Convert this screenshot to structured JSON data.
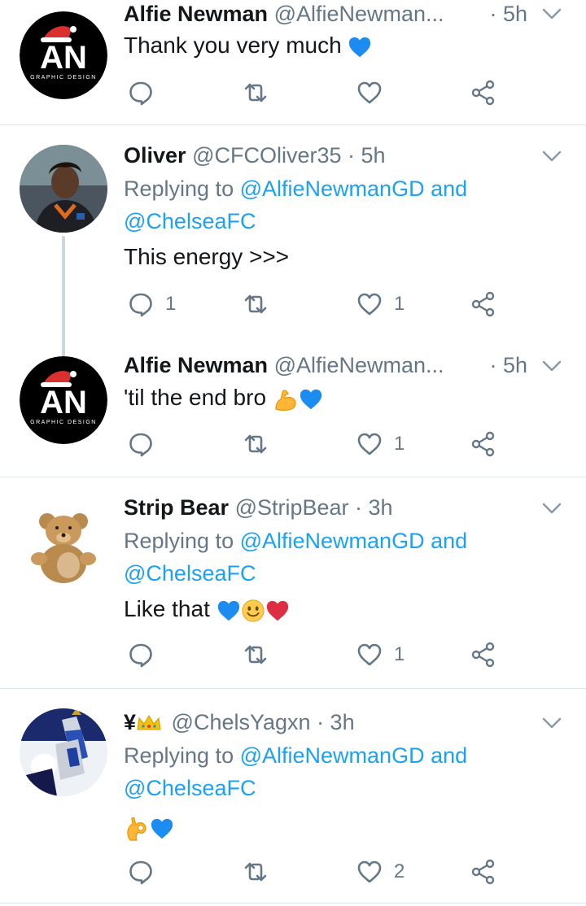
{
  "tweets": [
    {
      "name": "Alfie Newman",
      "handle": "@AlfieNewman...",
      "time": "· 5h",
      "text": "Thank you very much",
      "emoji": [
        "blue-heart"
      ],
      "actions": {
        "reply": "",
        "retweet": "",
        "like": "",
        "share": ""
      }
    },
    {
      "name": "Oliver",
      "handle": "@CFCOliver35",
      "time": "· 5h",
      "replying_prefix": "Replying to ",
      "replying_user": "@AlfieNewmanGD",
      "replying_and": " and",
      "replying_user2": "@ChelseaFC",
      "text": "This energy >>>",
      "actions": {
        "reply": "1",
        "retweet": "",
        "like": "1",
        "share": ""
      }
    },
    {
      "name": "Alfie Newman",
      "handle": "@AlfieNewman...",
      "time": "· 5h",
      "text": "'til the end bro",
      "emoji": [
        "flexed-biceps",
        "blue-heart"
      ],
      "actions": {
        "reply": "",
        "retweet": "",
        "like": "1",
        "share": ""
      }
    },
    {
      "name": "Strip Bear",
      "handle": "@StripBear",
      "time": "· 3h",
      "replying_prefix": "Replying to ",
      "replying_user": "@AlfieNewmanGD",
      "replying_and": " and",
      "replying_user2": "@ChelseaFC",
      "text": "Like that",
      "emoji": [
        "blue-heart",
        "slight-smile",
        "red-heart"
      ],
      "actions": {
        "reply": "",
        "retweet": "",
        "like": "1",
        "share": ""
      }
    },
    {
      "name": "¥",
      "handle": "@ChelsYagxn",
      "time": "· 3h",
      "replying_prefix": "Replying to ",
      "replying_user": "@AlfieNewmanGD",
      "replying_and": " and",
      "replying_user2": "@ChelseaFC",
      "text": "",
      "emoji": [
        "ok-hand",
        "blue-heart"
      ],
      "actions": {
        "reply": "",
        "retweet": "",
        "like": "2",
        "share": ""
      }
    }
  ],
  "logo": {
    "letters": "AN",
    "tagline": "GRAPHIC DESIGN"
  },
  "colors": {
    "link": "#1da1f2",
    "muted": "#657786",
    "text": "#14171a",
    "divider": "#e1e8ed",
    "blue_heart": "#1d8cf0",
    "red_heart": "#dd2e44"
  }
}
